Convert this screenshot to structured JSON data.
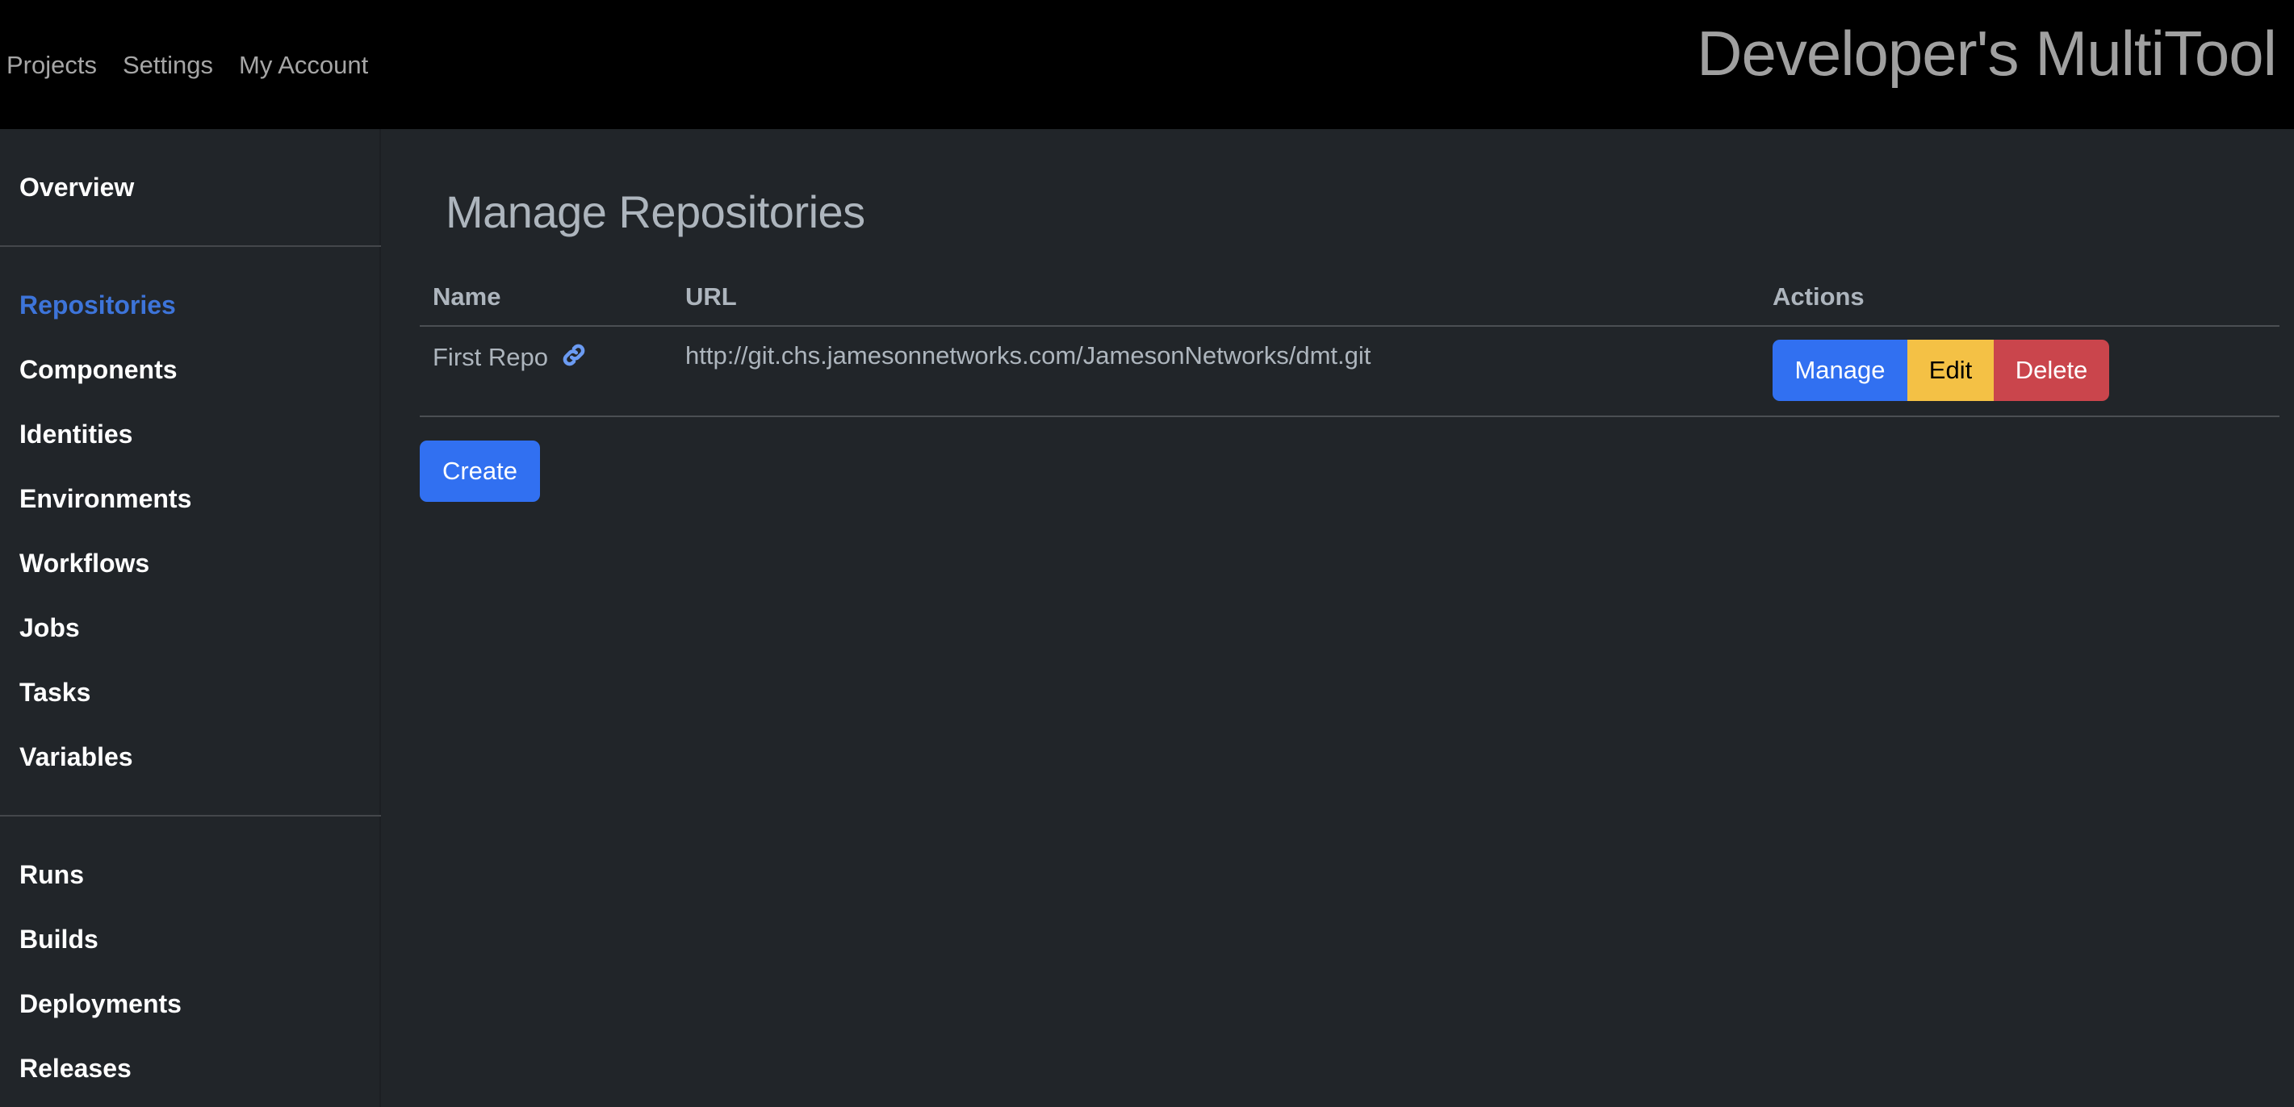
{
  "topbar": {
    "nav": [
      {
        "label": "Projects"
      },
      {
        "label": "Settings"
      },
      {
        "label": "My Account"
      }
    ],
    "brand": "Developer's MultiTool"
  },
  "sidebar": {
    "group1": [
      {
        "label": "Overview",
        "active": false
      }
    ],
    "group2": [
      {
        "label": "Repositories",
        "active": true
      },
      {
        "label": "Components",
        "active": false
      },
      {
        "label": "Identities",
        "active": false
      },
      {
        "label": "Environments",
        "active": false
      },
      {
        "label": "Workflows",
        "active": false
      },
      {
        "label": "Jobs",
        "active": false
      },
      {
        "label": "Tasks",
        "active": false
      },
      {
        "label": "Variables",
        "active": false
      }
    ],
    "group3": [
      {
        "label": "Runs",
        "active": false
      },
      {
        "label": "Builds",
        "active": false
      },
      {
        "label": "Deployments",
        "active": false
      },
      {
        "label": "Releases",
        "active": false
      }
    ]
  },
  "main": {
    "title": "Manage Repositories",
    "table": {
      "headers": [
        "Name",
        "URL",
        "Actions"
      ],
      "rows": [
        {
          "name": "First Repo",
          "name_icon": "link-icon",
          "url": "http://git.chs.jamesonnetworks.com/JamesonNetworks/dmt.git",
          "actions": {
            "manage": "Manage",
            "edit": "Edit",
            "delete": "Delete"
          }
        }
      ]
    },
    "create_label": "Create"
  },
  "colors": {
    "primary": "#3170f1",
    "warning": "#f4c145",
    "danger": "#ca454c",
    "active_link": "#3d74d9",
    "link_icon": "#6b9bf2",
    "background": "#212529",
    "topbar": "#000000"
  }
}
